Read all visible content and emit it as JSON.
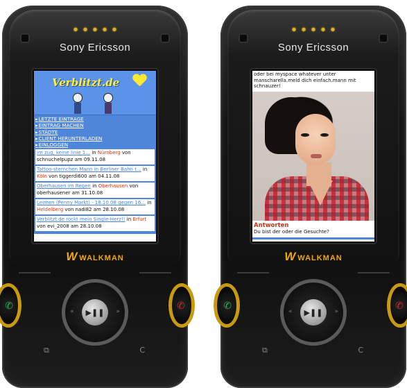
{
  "left_phone": {
    "brand": "Sony Ericsson",
    "walkman": "WALKMAN",
    "site_logo": "Verblitzt.de",
    "menu": [
      "LETZTE EINTRAGE",
      "EINTRAG MACHEN",
      "STÄDTE",
      "CLIENT HERUNTERLADEN",
      "EINLOGGEN"
    ],
    "entries": [
      {
        "title": "im zug, keine linie 1...",
        "in": "in",
        "city": "Nürnberg",
        "by": "von schnuchelpupz am 09.11.08"
      },
      {
        "title": "Tattoo-sternchen Mann in Berliner Bahn t...",
        "in": "in",
        "city": "Köln",
        "by": "von tiggerdi600 am 04.11.08"
      },
      {
        "title": "Oberhausen im Regen",
        "in": "in",
        "city": "Oberhausen",
        "by": "von oberhausener am 31.10.08"
      },
      {
        "title": "Leimen (Penny Markt) - 18.10.08 gegen 16...",
        "in": "in",
        "city": "Heidelberg",
        "by": "von nadi82 am 28.10.08"
      },
      {
        "title": "Verblitzt.de rockt mein Single-Herz!!",
        "in": "in",
        "city": "Erfurt",
        "by": "von evi_2008 am 28.10.08"
      }
    ]
  },
  "right_phone": {
    "brand": "Sony Ericsson",
    "walkman": "WALKMAN",
    "message": "oder bei myspace whatever unter manscharella.meld dich einfach.mann mit schnauzer!",
    "reply_title": "Antworten",
    "reply_text": "Du bist der oder die Gesuchte?"
  },
  "keypad": {
    "soft_left": "⧉",
    "soft_right": "C",
    "center": "▶❚❚",
    "prev": "«",
    "next": "»"
  },
  "colors": {
    "site_blue": "#4f86da",
    "logo_yellow": "#ffef3a",
    "walkman_orange": "#f2a800",
    "city_red": "#d63a1a",
    "call_green": "#29b34d",
    "end_red": "#d22a2a"
  }
}
